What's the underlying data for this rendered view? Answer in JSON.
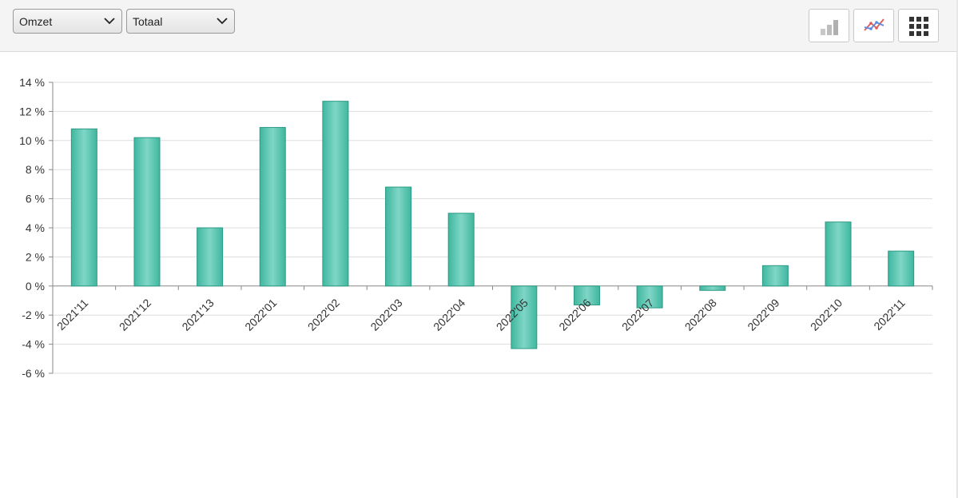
{
  "toolbar": {
    "metric_select": {
      "value": "Omzet"
    },
    "scope_select": {
      "value": "Totaal"
    },
    "buttons": [
      {
        "icon": "bar-chart-icon"
      },
      {
        "icon": "line-chart-icon"
      },
      {
        "icon": "grid-icon"
      }
    ]
  },
  "colors": {
    "bar_fill_light": "#7fd6c6",
    "bar_fill_dark": "#3fb79f",
    "bar_stroke": "#2a9a85",
    "grid": "#dddddd",
    "axis": "#888888"
  },
  "chart_data": {
    "type": "bar",
    "categories": [
      "2021'11",
      "2021'12",
      "2021'13",
      "2022'01",
      "2022'02",
      "2022'03",
      "2022'04",
      "2022'05",
      "2022'06",
      "2022'07",
      "2022'08",
      "2022'09",
      "2022'10",
      "2022'11"
    ],
    "values": [
      10.8,
      10.2,
      4.0,
      10.9,
      12.7,
      6.8,
      5.0,
      -4.3,
      -1.3,
      -1.5,
      -0.3,
      1.4,
      4.4,
      2.4
    ],
    "ylim": [
      -6,
      14
    ],
    "yticks": [
      14,
      12,
      10,
      8,
      6,
      4,
      2,
      0,
      -2,
      -4,
      -6
    ],
    "ytick_labels": [
      "14 %",
      "12 %",
      "10 %",
      "8 %",
      "6 %",
      "4 %",
      "2 %",
      "0 %",
      "-2 %",
      "-4 %",
      "-6 %"
    ],
    "grid": true,
    "title": "",
    "xlabel": "",
    "ylabel": ""
  }
}
